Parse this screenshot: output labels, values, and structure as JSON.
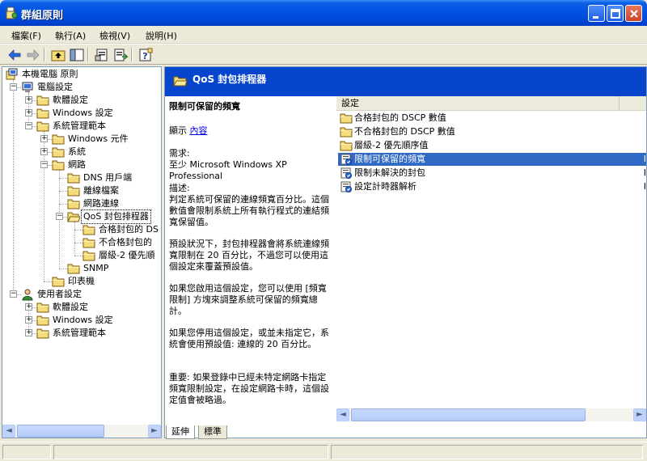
{
  "window": {
    "title": "群組原則"
  },
  "menu": [
    "檔案(F)",
    "執行(A)",
    "檢視(V)",
    "說明(H)"
  ],
  "tree": [
    {
      "label": "本機電腦 原則",
      "level": 0,
      "icon": "computer-policy-icon",
      "expander": ""
    },
    {
      "label": "電腦設定",
      "level": 1,
      "icon": "computer-icon",
      "expander": "−"
    },
    {
      "label": "軟體設定",
      "level": 2,
      "icon": "folder-icon",
      "expander": "+"
    },
    {
      "label": "Windows 設定",
      "level": 2,
      "icon": "folder-icon",
      "expander": "+"
    },
    {
      "label": "系統管理範本",
      "level": 2,
      "icon": "folder-icon",
      "expander": "−"
    },
    {
      "label": "Windows 元件",
      "level": 3,
      "icon": "folder-icon",
      "expander": "+"
    },
    {
      "label": "系統",
      "level": 3,
      "icon": "folder-icon",
      "expander": "+"
    },
    {
      "label": "網路",
      "level": 3,
      "icon": "folder-icon",
      "expander": "−"
    },
    {
      "label": "DNS 用戶端",
      "level": 4,
      "icon": "folder-icon",
      "expander": ""
    },
    {
      "label": "離線檔案",
      "level": 4,
      "icon": "folder-icon",
      "expander": ""
    },
    {
      "label": "網路連線",
      "level": 4,
      "icon": "folder-icon",
      "expander": ""
    },
    {
      "label": "QoS 封包排程器",
      "level": 4,
      "icon": "open-folder-icon",
      "expander": "−",
      "selected": true
    },
    {
      "label": "合格封包的 DS",
      "level": 5,
      "icon": "folder-icon",
      "expander": ""
    },
    {
      "label": "不合格封包的",
      "level": 5,
      "icon": "folder-icon",
      "expander": ""
    },
    {
      "label": "層級-2 優先順",
      "level": 5,
      "icon": "folder-icon",
      "expander": ""
    },
    {
      "label": "SNMP",
      "level": 4,
      "icon": "folder-icon",
      "expander": ""
    },
    {
      "label": "印表機",
      "level": 3,
      "icon": "folder-icon",
      "expander": ""
    },
    {
      "label": "使用者設定",
      "level": 1,
      "icon": "user-icon",
      "expander": "−"
    },
    {
      "label": "軟體設定",
      "level": 2,
      "icon": "folder-icon",
      "expander": "+"
    },
    {
      "label": "Windows 設定",
      "level": 2,
      "icon": "folder-icon",
      "expander": "+"
    },
    {
      "label": "系統管理範本",
      "level": 2,
      "icon": "folder-icon",
      "expander": "+"
    }
  ],
  "header": {
    "title": "QoS 封包排程器"
  },
  "description": {
    "title": "限制可保留的頻寬",
    "display_prefix": "顯示",
    "display_link": "內容",
    "requirement_label": "需求:",
    "requirement_value": "至少 Microsoft Windows XP Professional",
    "desc_label": "描述:",
    "desc_p1": "判定系統可保留的連線頻寬百分比。這個數值會限制系統上所有執行程式的連結頻寬保留值。",
    "desc_p2": "預設狀況下，封包排程器會將系統連線頻寬限制在 20 百分比，不過您可以使用這個設定來覆蓋預設值。",
    "desc_p3": "如果您啟用這個設定，您可以使用 [頻寬限制] 方塊來調整系統可保留的頻寬總計。",
    "desc_p4": "如果您停用這個設定，或並未指定它，系統會使用預設值: 連線的 20 百分比。",
    "desc_p5": "重要: 如果登錄中已經未特定網路卡指定頻寬限制設定，在設定網路卡時，這個設定值會被略過。"
  },
  "list": {
    "column": "設定",
    "rows": [
      {
        "label": "合格封包的 DSCP 數值",
        "icon": "folder-icon",
        "trail": ""
      },
      {
        "label": "不合格封包的 DSCP 數值",
        "icon": "folder-icon",
        "trail": ""
      },
      {
        "label": "層級-2 優先順序值",
        "icon": "folder-icon",
        "trail": ""
      },
      {
        "label": "限制可保留的頻寬",
        "icon": "policy-setting-icon",
        "trail": "I",
        "selected": true
      },
      {
        "label": "限制未解決的封包",
        "icon": "policy-setting-icon",
        "trail": "I"
      },
      {
        "label": "設定計時器解析",
        "icon": "policy-setting-icon",
        "trail": "I"
      }
    ]
  },
  "tabs": [
    "延伸",
    "標準"
  ]
}
